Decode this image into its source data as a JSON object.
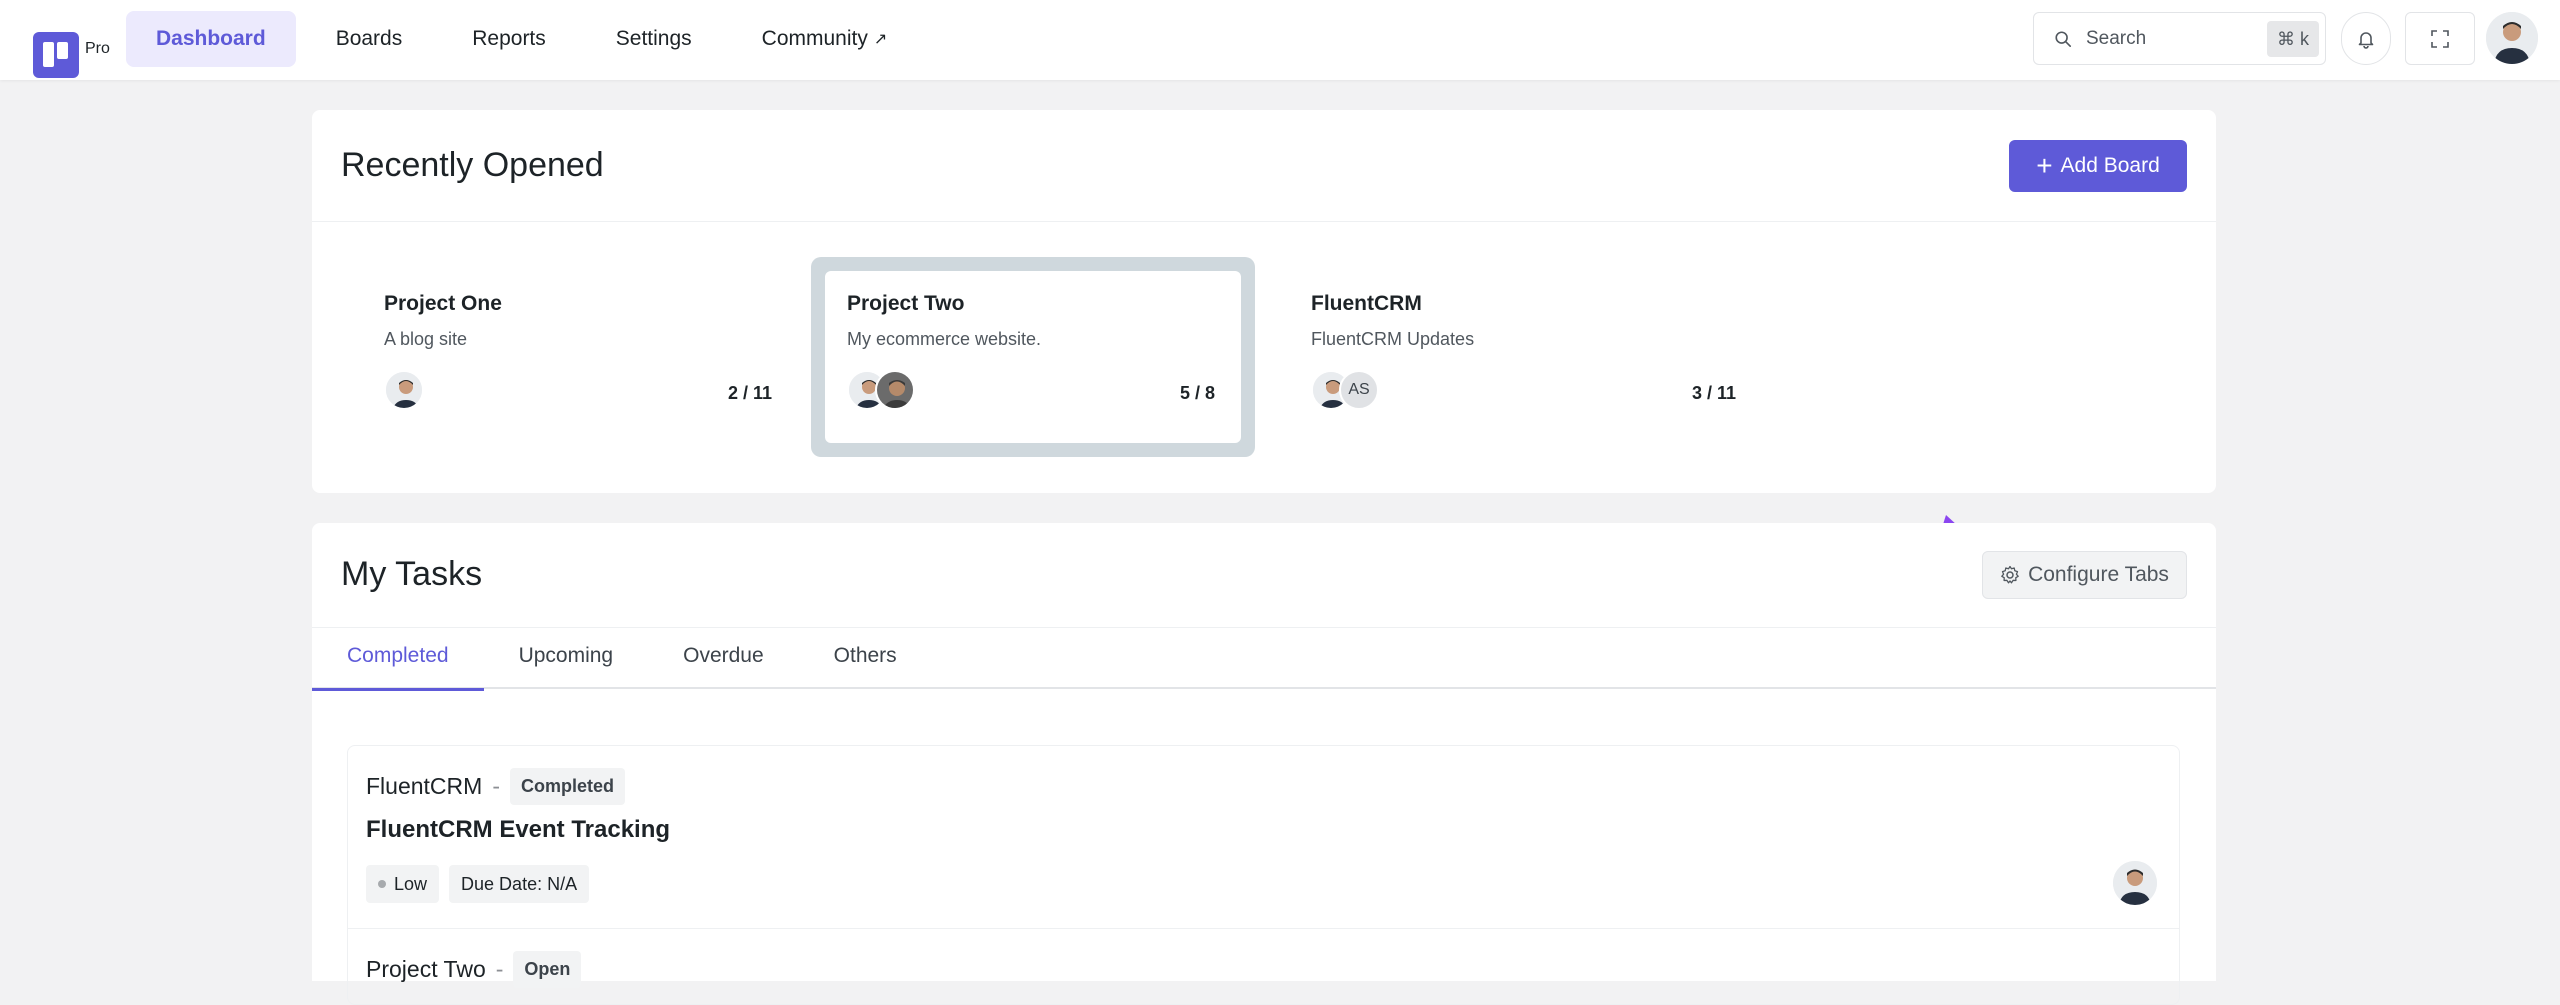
{
  "header": {
    "logo_text": "Pro",
    "nav": [
      {
        "label": "Dashboard",
        "active": true
      },
      {
        "label": "Boards"
      },
      {
        "label": "Reports"
      },
      {
        "label": "Settings"
      },
      {
        "label": "Community",
        "external_glyph": "↗"
      }
    ],
    "search": {
      "label": "Search",
      "shortcut": "⌘ k"
    },
    "icons": [
      "bell-icon",
      "expand-icon",
      "user-avatar"
    ]
  },
  "recent": {
    "title": "Recently Opened",
    "add_board_label": "Add Board",
    "boards": [
      {
        "name": "Project One",
        "description": "A blog site",
        "progress": "2 / 11",
        "members": [
          "avatar"
        ]
      },
      {
        "name": "Project Two",
        "description": "My ecommerce website.",
        "progress": "5 / 8",
        "members": [
          "avatar",
          "avatar"
        ],
        "selected": true
      },
      {
        "name": "FluentCRM",
        "description": "FluentCRM Updates",
        "progress": "3 / 11",
        "members": [
          "avatar",
          "AS"
        ]
      }
    ]
  },
  "tasks": {
    "title": "My Tasks",
    "configure_label": "Configure Tabs",
    "tabs": [
      {
        "label": "Completed",
        "active": true
      },
      {
        "label": "Upcoming"
      },
      {
        "label": "Overdue"
      },
      {
        "label": "Others"
      }
    ],
    "items": [
      {
        "board": "FluentCRM",
        "status": "Completed",
        "title": "FluentCRM Event Tracking",
        "priority": "Low",
        "due_label": "Due Date:",
        "due_value": "N/A"
      },
      {
        "board": "Project Two",
        "status": "Open"
      }
    ]
  },
  "colors": {
    "accent": "#5e5ad8",
    "annotation_arrow": "#8b46f0"
  }
}
